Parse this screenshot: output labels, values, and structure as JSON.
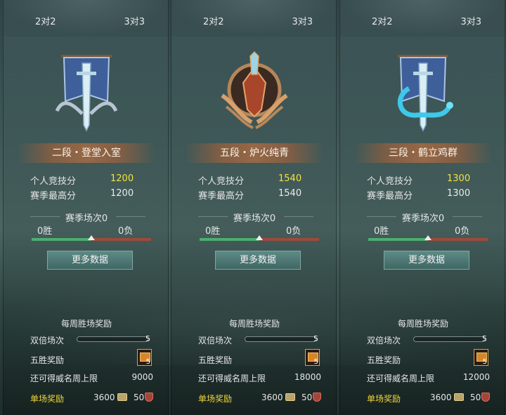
{
  "tabs": [
    "2对2",
    "3对3"
  ],
  "labels": {
    "personal_score": "个人竞技分",
    "season_high": "赛季最高分",
    "more_data": "更多数据",
    "weekly_reward": "每周胜场奖励",
    "double_matches": "双倍场次",
    "five_win_reward": "五胜奖励",
    "renown_limit": "还可得威名周上限",
    "single_reward": "单场奖励"
  },
  "panels": [
    {
      "rank": "二段・登堂入室",
      "score": "1200",
      "high": "1200",
      "season": "赛季场次0",
      "wins": "0胜",
      "losses": "0负",
      "double_count": "5",
      "five_win_count": "5",
      "renown": "9000",
      "coins": "3600",
      "badges": "50"
    },
    {
      "rank": "五段・炉火纯青",
      "score": "1540",
      "high": "1540",
      "season": "赛季场次0",
      "wins": "0胜",
      "losses": "0负",
      "double_count": "5",
      "five_win_count": "5",
      "renown": "18000",
      "coins": "3600",
      "badges": "50"
    },
    {
      "rank": "三段・鹤立鸡群",
      "score": "1300",
      "high": "1300",
      "season": "赛季场次0",
      "wins": "0胜",
      "losses": "0负",
      "double_count": "5",
      "five_win_count": "5",
      "renown": "12000",
      "coins": "3600",
      "badges": "50"
    }
  ],
  "colors": {
    "score_highlight": "#f5e23a",
    "win_bar": "#4caf6d",
    "loss_bar": "#9e4a3a"
  },
  "icons": [
    "banner-sword-emblem",
    "bronze-wing-emblem",
    "dragon-sword-emblem",
    "chest-icon",
    "coin-icon",
    "badge-icon"
  ]
}
